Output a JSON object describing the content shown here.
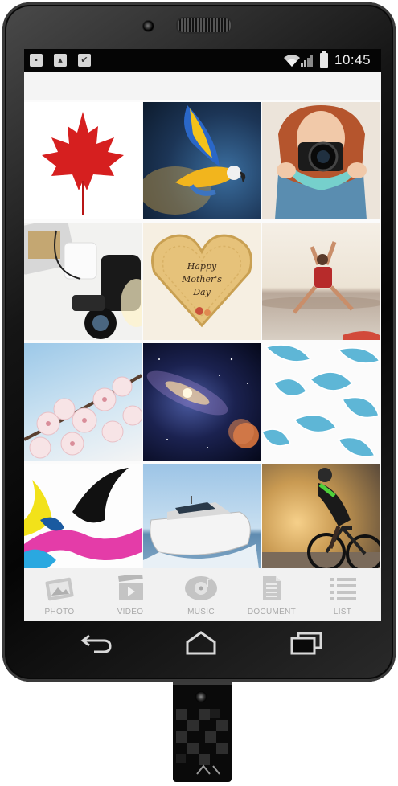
{
  "status_bar": {
    "left_icons": [
      "sd-card-icon",
      "image-icon",
      "check-icon"
    ],
    "time": "10:45"
  },
  "gallery": {
    "items": [
      {
        "subject": "maple-leaf"
      },
      {
        "subject": "macaw"
      },
      {
        "subject": "woman-camera"
      },
      {
        "subject": "desk-camera"
      },
      {
        "subject": "mothers-day-heart",
        "text": "Happy Mother's Day"
      },
      {
        "subject": "beach-jump"
      },
      {
        "subject": "cherry-blossom"
      },
      {
        "subject": "galaxy"
      },
      {
        "subject": "blue-leaves"
      },
      {
        "subject": "paint-splash"
      },
      {
        "subject": "speedboat"
      },
      {
        "subject": "cyclist"
      }
    ]
  },
  "tabs": [
    {
      "label": "PHOTO",
      "icon": "photo-icon"
    },
    {
      "label": "VIDEO",
      "icon": "video-icon"
    },
    {
      "label": "MUSIC",
      "icon": "music-icon"
    },
    {
      "label": "DOCUMENT",
      "icon": "document-icon"
    },
    {
      "label": "LIST",
      "icon": "list-icon"
    }
  ],
  "nav_buttons": [
    "back-icon",
    "home-icon",
    "recents-icon"
  ],
  "colors": {
    "bezel": "#0d0d0d",
    "tab_label": "#a9a9a9",
    "status_bar": "#050505"
  }
}
